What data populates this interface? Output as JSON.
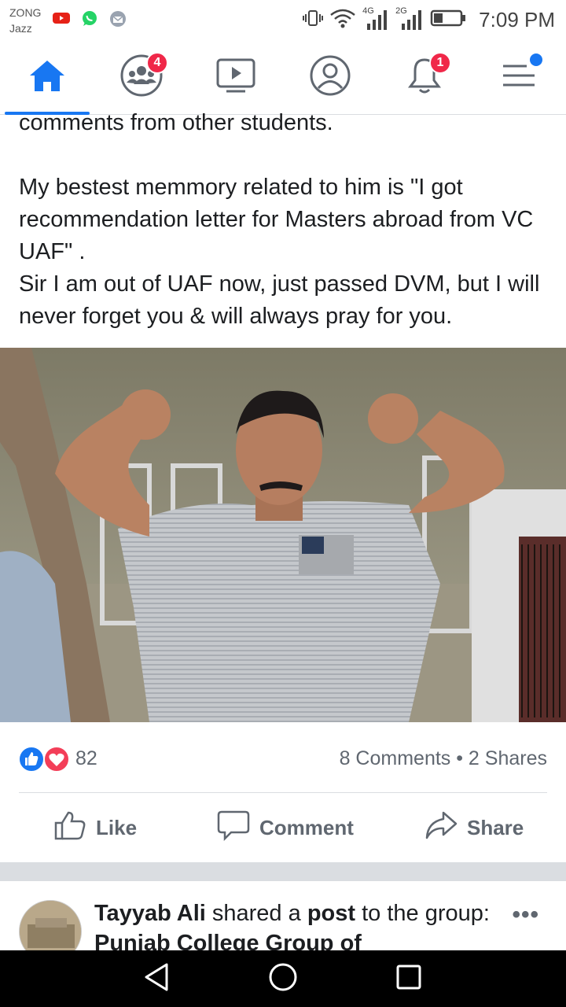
{
  "status_bar": {
    "carrier_1": "ZONG",
    "carrier_2": "Jazz",
    "net_1": "4G",
    "net_2": "2G",
    "time": "7:09 PM",
    "icons": [
      "youtube-icon",
      "whatsapp-icon",
      "messenger-icon",
      "vibrate-icon",
      "wifi-icon",
      "signal-icon",
      "battery-icon"
    ]
  },
  "nav": {
    "tabs": [
      {
        "name": "home",
        "icon": "home-icon",
        "active": true
      },
      {
        "name": "groups",
        "icon": "groups-icon",
        "badge": "4"
      },
      {
        "name": "watch",
        "icon": "watch-icon"
      },
      {
        "name": "profile",
        "icon": "profile-icon"
      },
      {
        "name": "notifications",
        "icon": "bell-icon",
        "badge": "1"
      },
      {
        "name": "menu",
        "icon": "menu-icon",
        "dot": true
      }
    ],
    "accent": "#1877f2"
  },
  "post": {
    "text_lines": [
      "comments from other students.",
      "",
      "My bestest memmory related to him is \"I got recommendation letter for Masters abroad from VC UAF\" .",
      "Sir I am out of UAF now, just passed DVM, but I will never forget you & will always pray for you."
    ],
    "reaction_count": "82",
    "stats": "8 Comments • 2 Shares",
    "actions": {
      "like": "Like",
      "comment": "Comment",
      "share": "Share"
    }
  },
  "next_post": {
    "author": "Tayyab Ali",
    "verb": "shared a",
    "object": "post",
    "connector": "to the",
    "group_prefix": "group:",
    "group_name": "Punjab College Group of",
    "more": "•••"
  }
}
